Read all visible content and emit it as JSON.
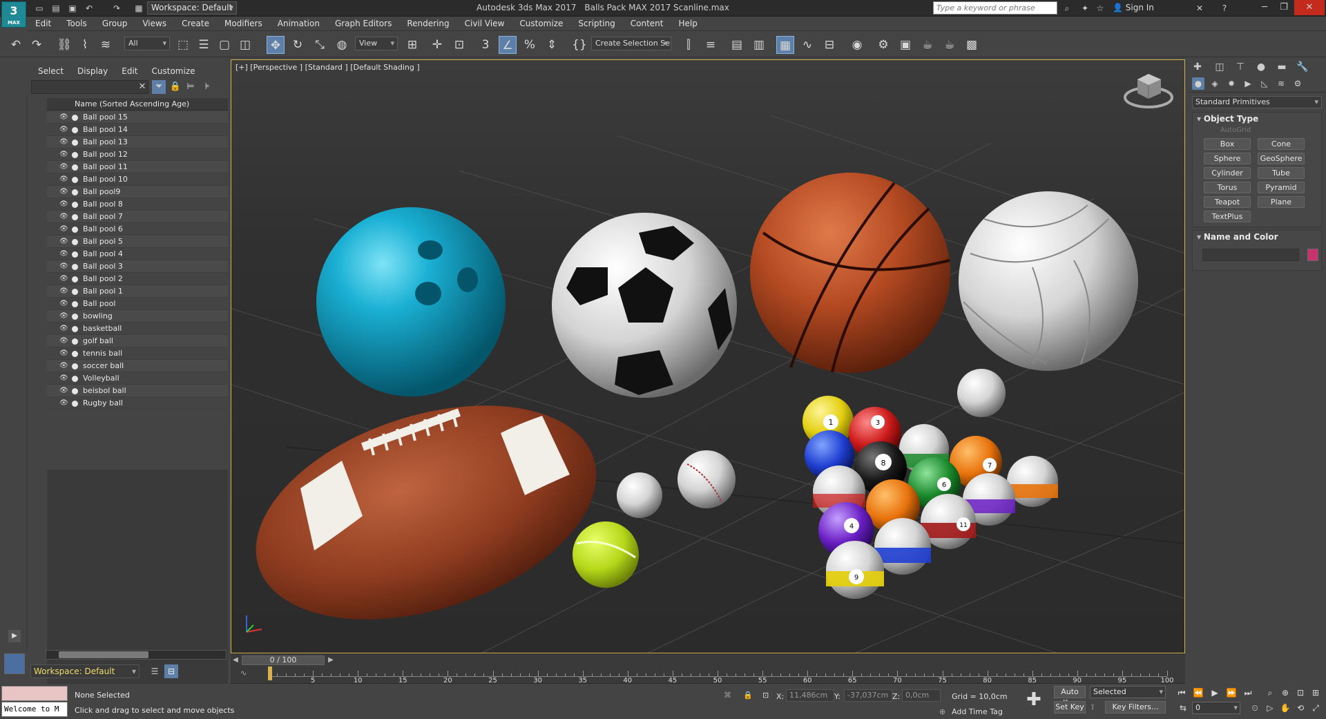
{
  "app": {
    "logo_text": "3",
    "logo_sub": "MAX",
    "title": "Autodesk 3ds Max 2017",
    "file": "Balls Pack MAX 2017 Scanline.max",
    "workspace": "Workspace: Default",
    "search_placeholder": "Type a keyword or phrase",
    "signin": "Sign In"
  },
  "menu": [
    "Edit",
    "Tools",
    "Group",
    "Views",
    "Create",
    "Modifiers",
    "Animation",
    "Graph Editors",
    "Rendering",
    "Civil View",
    "Customize",
    "Scripting",
    "Content",
    "Help"
  ],
  "toolbar": {
    "selection_filter": "All",
    "ref_coord": "View",
    "named_selection": "Create Selection Se"
  },
  "scene_explorer": {
    "menu": [
      "Select",
      "Display",
      "Edit",
      "Customize"
    ],
    "column_header": "Name (Sorted Ascending Age)",
    "items": [
      "Ball pool 15",
      "Ball pool 14",
      "Ball pool 13",
      "Ball pool 12",
      "Ball pool 11",
      "Ball pool 10",
      "Ball pool9",
      "Ball pool 8",
      "Ball pool 7",
      "Ball pool 6",
      "Ball pool 5",
      "Ball pool 4",
      "Ball pool 3",
      "Ball pool 2",
      "Ball pool 1",
      "Ball pool",
      "bowling",
      "basketball",
      "golf ball",
      "tennis ball",
      "soccer ball",
      "Volleyball",
      "beisbol ball",
      "Rugby ball"
    ],
    "workspace": "Workspace: Default"
  },
  "viewport": {
    "label": "[+] [Perspective ] [Standard ] [Default Shading ]"
  },
  "command_panel": {
    "category": "Standard Primitives",
    "object_type_title": "Object Type",
    "autogrid": "AutoGrid",
    "buttons": [
      "Box",
      "Cone",
      "Sphere",
      "GeoSphere",
      "Cylinder",
      "Tube",
      "Torus",
      "Pyramid",
      "Teapot",
      "Plane",
      "TextPlus"
    ],
    "name_color_title": "Name and Color",
    "swatch_color": "#c8336d"
  },
  "timeline": {
    "slider": "0 / 100",
    "labels": [
      "5",
      "10",
      "15",
      "20",
      "25",
      "30",
      "35",
      "40",
      "45",
      "50",
      "55",
      "60",
      "65",
      "70",
      "75",
      "80",
      "85",
      "90",
      "95",
      "100"
    ]
  },
  "status": {
    "maxscript": "Welcome to M",
    "selection": "None Selected",
    "prompt": "Click and drag to select and move objects",
    "x_label": "X:",
    "x": "11,486cm",
    "y_label": "Y:",
    "y": "-37,037cm",
    "z_label": "Z:",
    "z": "0,0cm",
    "grid": "Grid = 10,0cm",
    "add_time_tag": "Add Time Tag",
    "auto_key": "Auto Key",
    "set_key": "Set Key",
    "key_mode": "Selected",
    "key_filters": "Key Filters...",
    "frame": "0"
  }
}
